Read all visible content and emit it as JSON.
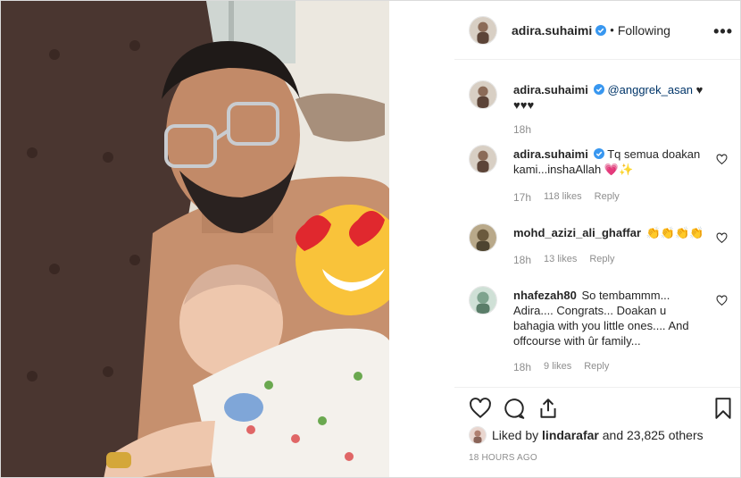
{
  "header": {
    "username": "adira.suhaimi",
    "separator": "•",
    "follow_status": "Following",
    "more_label": "•••"
  },
  "comments": [
    {
      "username": "adira.suhaimi",
      "mention": "@anggrek_asan",
      "text": " ♥ ♥♥♥",
      "time": "18h",
      "verified": true
    },
    {
      "username": "adira.suhaimi",
      "text": "Tq semua doakan kami...inshaAllah 💗✨",
      "time": "17h",
      "likes": "118 likes",
      "reply": "Reply",
      "verified": true
    },
    {
      "username": "mohd_azizi_ali_ghaffar",
      "text": "👏👏👏👏",
      "time": "18h",
      "likes": "13 likes",
      "reply": "Reply"
    },
    {
      "username": "nhafezah80",
      "text": "So tembammm... Adira.... Congrats... Doakan u bahagia with you little ones.... And offcourse with ûr family...",
      "time": "18h",
      "likes": "9 likes",
      "reply": "Reply"
    }
  ],
  "actions": {
    "liked_by_prefix": "Liked by",
    "liked_by_user": "lindarafar",
    "liked_by_suffix": "and 23,825 others",
    "timestamp": "18 HOURS AGO"
  },
  "icons": [
    "heart-icon",
    "comment-icon",
    "share-icon",
    "bookmark-icon",
    "verified-icon",
    "more-icon"
  ],
  "colors": {
    "verified": "#3897f0",
    "muted": "#8e8e8e",
    "text": "#262626"
  }
}
